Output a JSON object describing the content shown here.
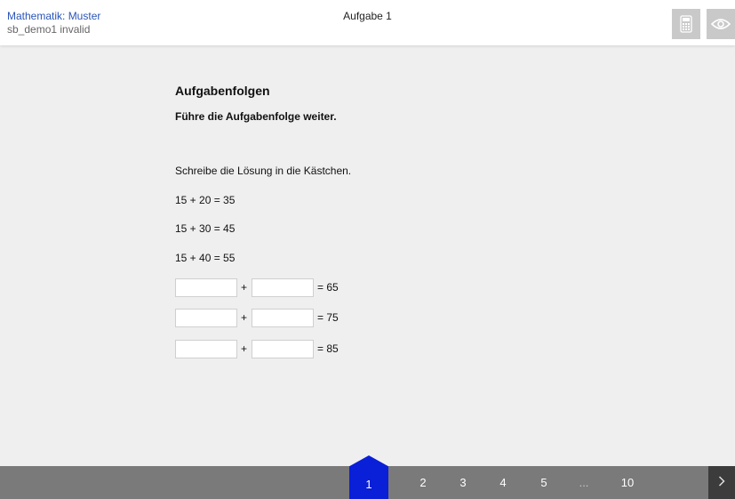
{
  "header": {
    "title": "Mathematik: Muster",
    "subtitle": "sb_demo1 invalid",
    "task": "Aufgabe 1",
    "calculator_icon": "calculator-icon",
    "eye_icon": "eye-icon",
    "button_color": "#c9c9c9"
  },
  "content": {
    "title": "Aufgabenfolgen",
    "subtitle": "Führe die Aufgabenfolge weiter.",
    "instruction": "Schreibe die Lösung in die Kästchen.",
    "equations": [
      "15 + 20 = 35",
      "15 + 30 = 45",
      "15 + 40 = 55"
    ],
    "rows": [
      {
        "operator": "+",
        "result": "= 65",
        "value1": "",
        "value2": ""
      },
      {
        "operator": "+",
        "result": "= 75",
        "value1": "",
        "value2": ""
      },
      {
        "operator": "+",
        "result": "= 85",
        "value1": "",
        "value2": ""
      }
    ]
  },
  "nav": {
    "active": "1",
    "items": [
      "2",
      "3",
      "4",
      "5",
      "...",
      "10"
    ],
    "next_icon": "chevron-right-icon",
    "active_color": "#0a1fd8",
    "bar_color": "#7a7a7a"
  }
}
